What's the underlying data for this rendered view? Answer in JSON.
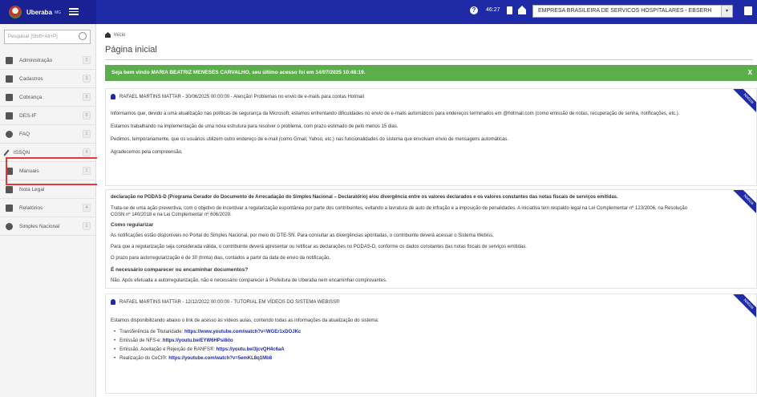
{
  "topbar": {
    "brand_name": "Uberaba",
    "brand_sub": "MG",
    "timer": "46:27",
    "company": "EMPRESA BRASILEIRA DE SERVICOS HOSPITALARES - EBSERH"
  },
  "sidebar": {
    "search_placeholder": "Pesquisar [Shift+Alt+P]",
    "items": [
      {
        "label": "Administração",
        "count": "2",
        "icon": "folder-icon"
      },
      {
        "label": "Cadastros",
        "count": "3",
        "icon": "book-icon"
      },
      {
        "label": "Cobrança",
        "count": "5",
        "icon": "wallet-icon"
      },
      {
        "label": "DES-IF",
        "count": "5",
        "icon": "bank-icon"
      },
      {
        "label": "FAQ",
        "count": "1",
        "icon": "question-icon"
      },
      {
        "label": "ISSQN",
        "count": "4",
        "icon": "pencil-icon"
      },
      {
        "label": "Manuais",
        "count": "1",
        "icon": "manual-icon"
      },
      {
        "label": "Nota Legal",
        "count": "",
        "icon": "note-icon"
      },
      {
        "label": "Relatórios",
        "count": "4",
        "icon": "report-icon"
      },
      {
        "label": "Simples Nacional",
        "count": "1",
        "icon": "globe-icon"
      }
    ]
  },
  "main": {
    "breadcrumb": "Início",
    "title": "Página inicial",
    "welcome": "Seja bem vindo MARIA BEATRIZ MENESES CARVALHO, seu último acesso foi em 14/07/2025 10:48:19.",
    "welcome_close": "X"
  },
  "notices": [
    {
      "ribbon": "Notícia",
      "header": "RAFAEL MARTINS MATTAR - 30/06/2025 00:00:00 - Atenção! Problemas no envio de e-mails para contas Hotmail",
      "lines": [
        "Informamos que, devido a uma atualização nas políticas de segurança da Microsoft, estamos enfrentando dificuldades no envio de e-mails automáticos para endereços terminados em @hotmail.com (como emissão de notas, recuperação de senha, notificações, etc.).",
        "Estamos trabalhando na implementação de uma nova estrutura para resolver o problema, com prazo estimado de pelo menos 15 dias.",
        "Pedimos, temporariamente, que os usuários utilizem outro endereço de e-mail (como Gmail, Yahoo, etc.) nas funcionalidades do sistema que envolvam envio de mensagens automáticas.",
        "Agradecemos pela compreensão."
      ]
    },
    {
      "ribbon": "Notícia",
      "header": "declaração no PGDAS-D (Programa Gerador do Documento de Arrecadação do Simples Nacional – Declaratório) e/ou divergência entre os valores declarados e os valores constantes das notas fiscais de serviços emitidas.",
      "lines": [
        "Trata-se de uma ação preventiva, com o objetivo de incentivar a regularização espontânea por parte dos contribuintes, evitando a lavratura de auto de infração e a imposição de penalidades. A iniciativa tem respaldo legal na Lei Complementar nº 123/2006, na Resolução",
        "CGSN nº 140/2018 e na Lei Complementar nº 606/2020.",
        "Como regularizar",
        "As notificações estão disponíveis no Portal do Simples Nacional, por meio do DTE-SN. Para consultar as divergências apontadas, o contribuinte deverá acessar o Sistema Webiss.",
        "Para que a regularização seja considerada válida, o contribuinte deverá apresentar ou retificar as declarações no PGDAS-D, conforme os dados constantes das notas fiscais de serviços emitidas.",
        "O prazo para autorregularização é de 30 (trinta) dias, contados a partir da data de envio da notificação.",
        "É necessário comparecer ou encaminhar documentos?",
        "Não. Após efetuada a autorregularização, não é necessário comparecer à Prefeitura de Uberaba nem encaminhar comprovantes."
      ]
    },
    {
      "ribbon": "Notícia",
      "header": "RAFAEL MARTINS MATTAR - 12/12/2022 00:00:00 - TUTORIAL EM VÍDEOS DO SISTEMA WEBISS®",
      "intro": "Estamos disponibilizando abaixo o link de acesso às vídeos aulas, contendo todas as informações da atualização do sistema:",
      "links": [
        {
          "label": "Transferência de Titularidade:",
          "url": "https://www.youtube.com/watch?v=WGEr1xDOJKc"
        },
        {
          "label": "Emissão de NFS-e:",
          "url": "https://youtu.be/EYW6HPsi8do"
        },
        {
          "label": "Emissão, Aceitação e Rejeição de RANFS®:",
          "url": "https://youtu.be/3jcvQH4c6aA"
        },
        {
          "label": "Realização do CeCI®:",
          "url": "https://youtube.com/watch?v=5emKL8q1Mb8"
        }
      ]
    }
  ]
}
